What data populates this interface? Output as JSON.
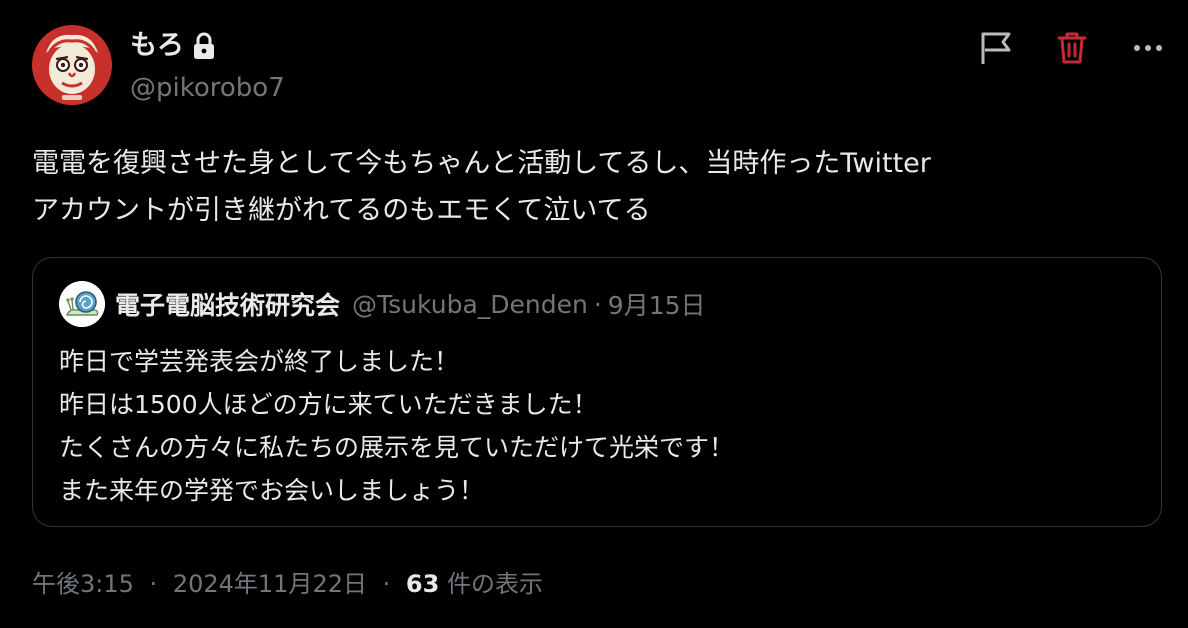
{
  "author": {
    "display_name": "もろ",
    "handle": "@pikorobo7",
    "avatar_icon": "red-face-avatar-icon",
    "protected_icon": "lock-icon"
  },
  "actions": {
    "report_icon": "flag-icon",
    "delete_icon": "trash-icon",
    "more_icon": "more-dots-icon",
    "delete_color": "#f4212e"
  },
  "post": {
    "lines": [
      "電電を復興させた身として今もちゃんと活動してるし、当時作ったTwitter",
      "アカウントが引き継がれてるのもエモくて泣いてる"
    ]
  },
  "quote": {
    "display_name": "電子電脳技術研究会",
    "handle": "@Tsukuba_Denden",
    "separator": "·",
    "date": "9月15日",
    "avatar_icon": "snail-logo-icon",
    "lines": [
      "昨日で学芸発表会が終了しました！",
      "昨日は1500人ほどの方に来ていただきました！",
      "たくさんの方々に私たちの展示を見ていただけて光栄です！",
      "また来年の学発でお会いしましょう！"
    ]
  },
  "meta": {
    "time": "午後3:15",
    "separator": "·",
    "date": "2024年11月22日",
    "views_count": "63",
    "views_label": "件の表示"
  },
  "colors": {
    "background": "#000000",
    "text_primary": "#e7e9ea",
    "text_secondary": "#71767b",
    "border": "#333639",
    "delete_red": "#f4212e"
  }
}
